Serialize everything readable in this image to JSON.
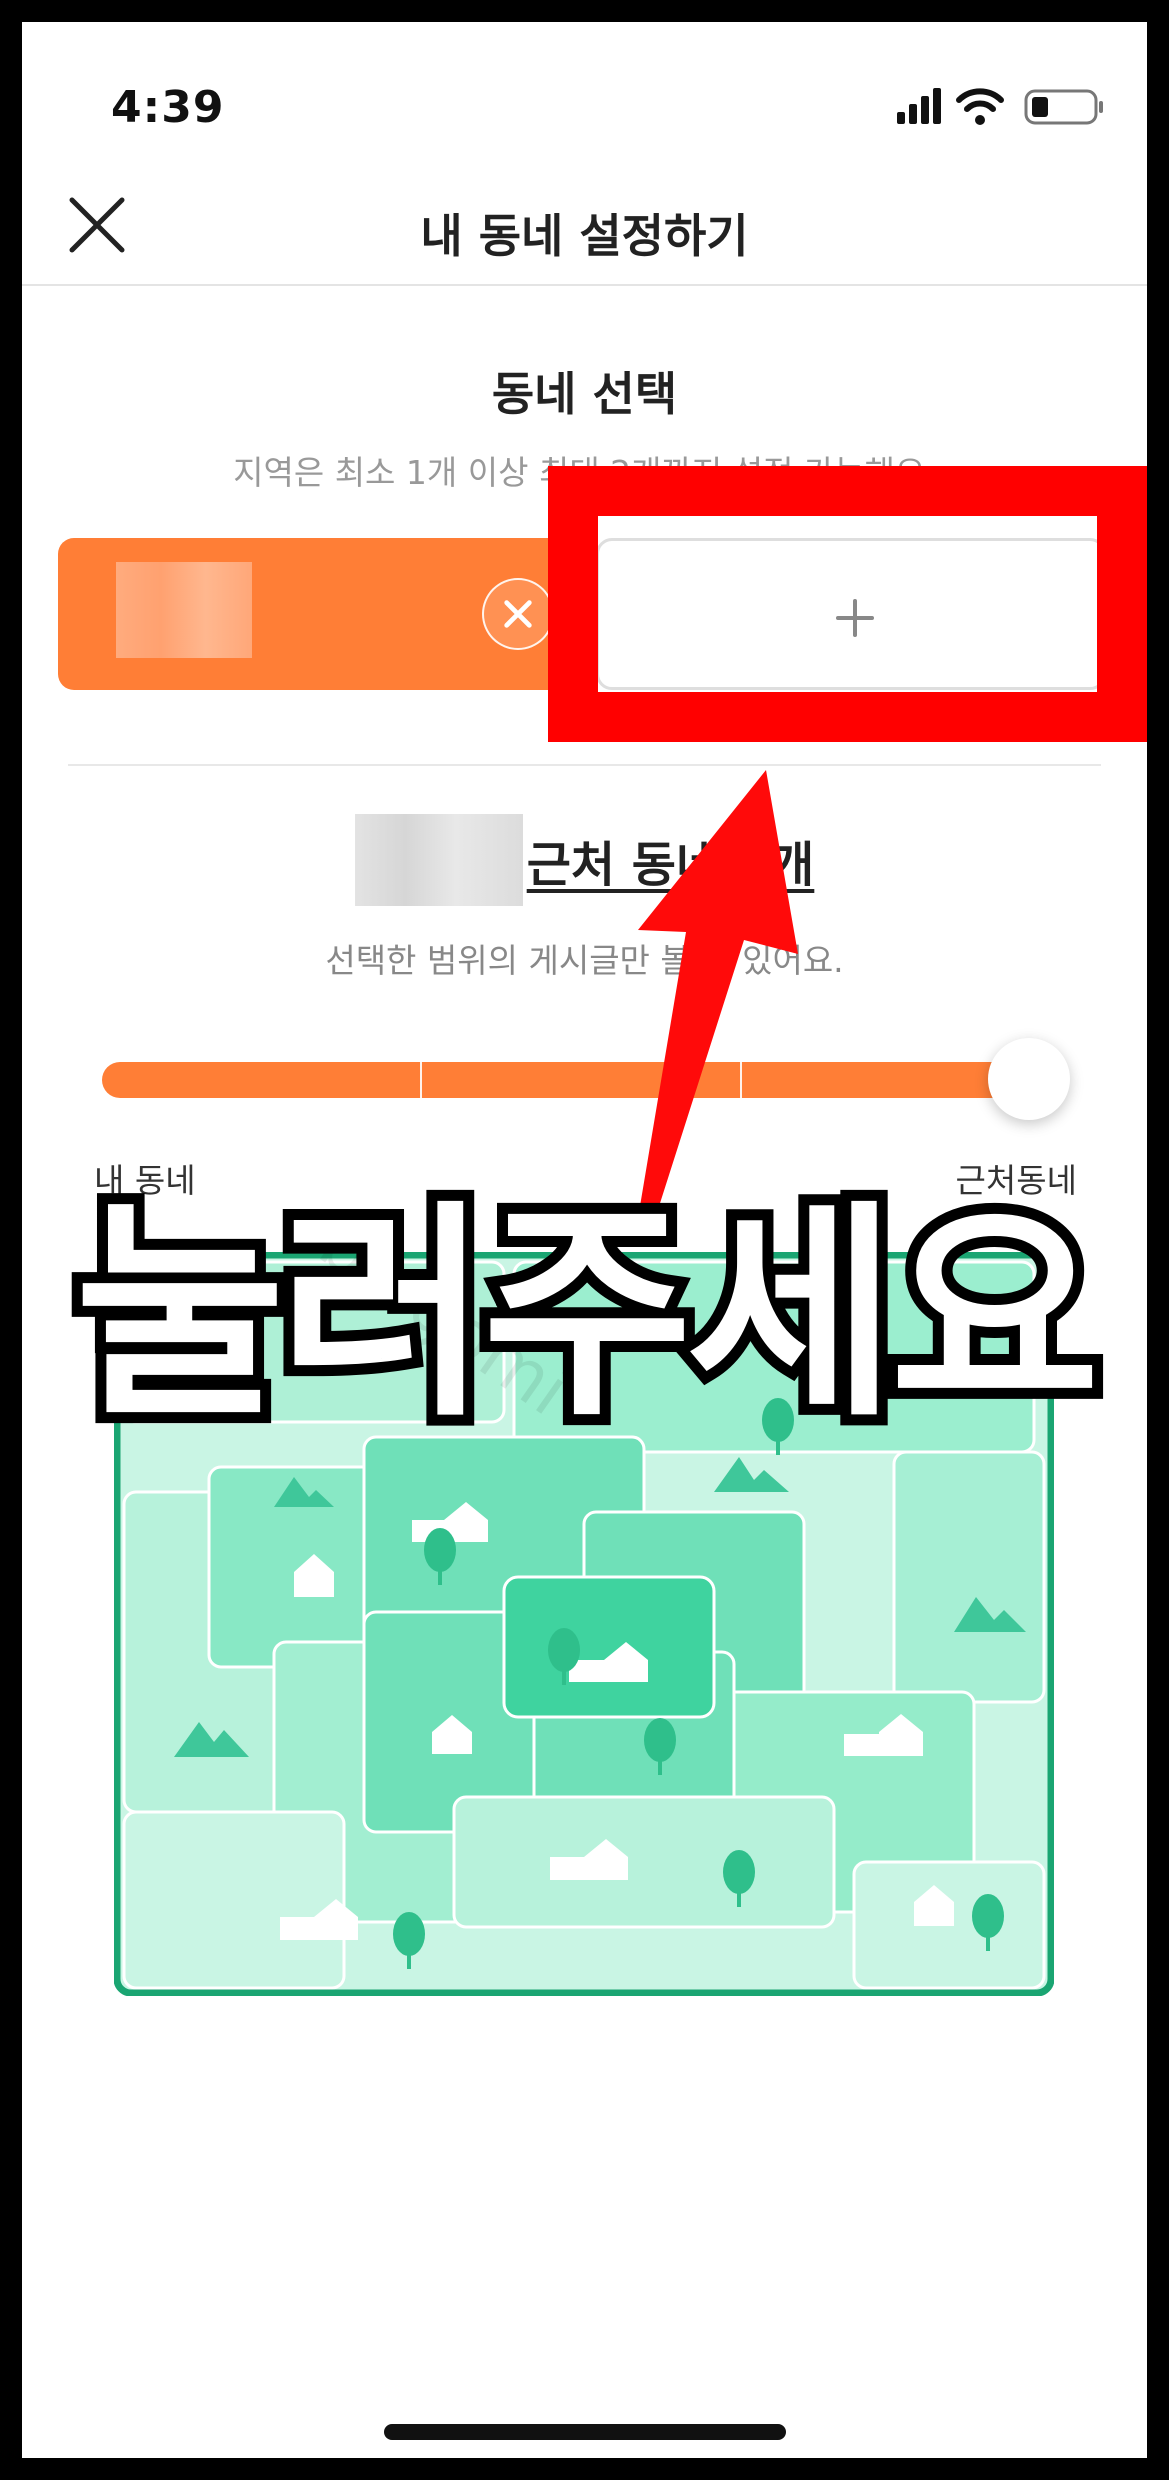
{
  "status_bar": {
    "time": "4:39",
    "icons": [
      "signal-icon",
      "wifi-icon",
      "battery-icon"
    ]
  },
  "header": {
    "title": "내 동네 설정하기",
    "close_icon": "close-icon"
  },
  "region_select": {
    "title": "동네 선택",
    "subtitle": "지역은 최소 1개 이상 최대 2개까지 설정 가능해요.",
    "add_icon": "plus-icon",
    "remove_icon": "close-circle-icon"
  },
  "range": {
    "text": "근처 동네 5개",
    "description": "선택한 범위의 게시글만 볼 수 있어요.",
    "slider_level": 1.0,
    "slider_steps": 4,
    "label_left": "내 동네",
    "label_right": "근처동네"
  },
  "overlay": {
    "caption": "눌러주세요",
    "watermark": "by gomi"
  },
  "colors": {
    "accent": "#ff7e36",
    "highlight": "#ff0000",
    "map_border": "#1aa572"
  }
}
